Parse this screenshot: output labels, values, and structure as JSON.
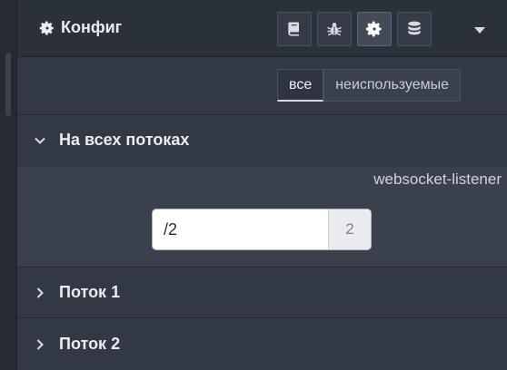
{
  "header": {
    "title": "Конфиг",
    "tabs": [
      {
        "icon": "book-icon",
        "active": false
      },
      {
        "icon": "bug-icon",
        "active": false
      },
      {
        "icon": "gear-icon",
        "active": true
      },
      {
        "icon": "database-icon",
        "active": false
      }
    ],
    "menu_icon": "caret-down-icon"
  },
  "filter": {
    "all_label": "все",
    "unused_label": "неиспользуемые",
    "selected": "все"
  },
  "sections": {
    "global": {
      "label": "На всех потоках",
      "expanded": true,
      "node_type": "websocket-listener",
      "node": {
        "label": "/2",
        "count": "2"
      }
    },
    "flow1": {
      "label": "Поток 1",
      "expanded": false
    },
    "flow2": {
      "label": "Поток 2",
      "expanded": false
    }
  },
  "colors": {
    "panel_bg": "#323945",
    "header_bg": "#2b313b",
    "text": "#e9ecf0",
    "node_bg": "#ffffff"
  }
}
